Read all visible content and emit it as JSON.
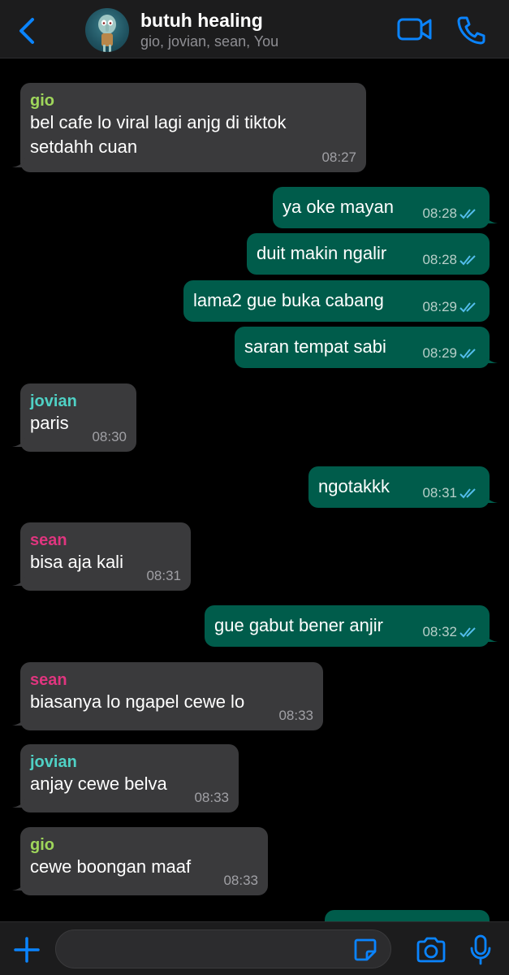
{
  "header": {
    "title": "butuh healing",
    "members": "gio, jovian, sean, You",
    "back_icon": "chevron-left-icon",
    "video_icon": "video-camera-icon",
    "call_icon": "phone-icon"
  },
  "colors": {
    "accent": "#0a84ff",
    "incoming_bubble": "#3a3a3c",
    "outgoing_bubble": "#005c4b",
    "gio": "#9fd65b",
    "jovian": "#4fd1c5",
    "sean": "#e0357f",
    "read_ticks": "#53bdeb"
  },
  "messages": [
    {
      "id": "m1",
      "sender": "gio",
      "text": "bel cafe lo viral lagi anjg di tiktok setdahh cuan",
      "time": "08:27"
    },
    {
      "id": "m2",
      "text": "ya oke mayan",
      "time": "08:28"
    },
    {
      "id": "m3",
      "text": "duit makin ngalir",
      "time": "08:28"
    },
    {
      "id": "m4",
      "text": "lama2 gue buka cabang",
      "time": "08:29"
    },
    {
      "id": "m5",
      "text": "saran tempat sabi",
      "time": "08:29"
    },
    {
      "id": "m6",
      "sender": "jovian",
      "text": "paris",
      "time": "08:30"
    },
    {
      "id": "m7",
      "text": "ngotakkk",
      "time": "08:31"
    },
    {
      "id": "m8",
      "sender": "sean",
      "text": "bisa aja kali",
      "time": "08:31"
    },
    {
      "id": "m9",
      "text": "gue gabut bener anjir",
      "time": "08:32"
    },
    {
      "id": "m10",
      "sender": "sean",
      "text": "biasanya lo ngapel cewe lo",
      "time": "08:33"
    },
    {
      "id": "m11",
      "sender": "jovian",
      "text": "anjay cewe belva",
      "time": "08:33"
    },
    {
      "id": "m12",
      "sender": "gio",
      "text": "cewe boongan maaf",
      "time": "08:33"
    }
  ],
  "composer": {
    "input_value": "",
    "plus_icon": "plus-icon",
    "sticker_icon": "sticker-icon",
    "camera_icon": "camera-icon",
    "mic_icon": "microphone-icon"
  }
}
